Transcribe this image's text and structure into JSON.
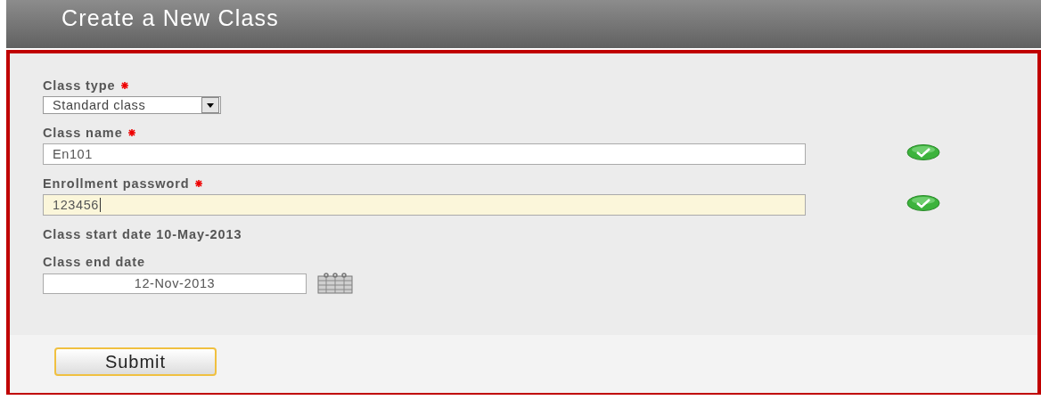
{
  "title": "Create a New Class",
  "fields": [
    {
      "kind": "select",
      "label": "Class type",
      "required": true,
      "value": "Standard class"
    },
    {
      "kind": "text",
      "label": "Class name",
      "required": true,
      "value": "En101",
      "valid": true,
      "focused": false
    },
    {
      "kind": "text",
      "label": "Enrollment password",
      "required": true,
      "value": "123456",
      "valid": true,
      "focused": true
    },
    {
      "kind": "static",
      "label": "Class start date 10-May-2013",
      "required": false
    },
    {
      "kind": "date",
      "label": "Class end date",
      "required": false,
      "value": "12-Nov-2013"
    }
  ],
  "submit": "Submit"
}
